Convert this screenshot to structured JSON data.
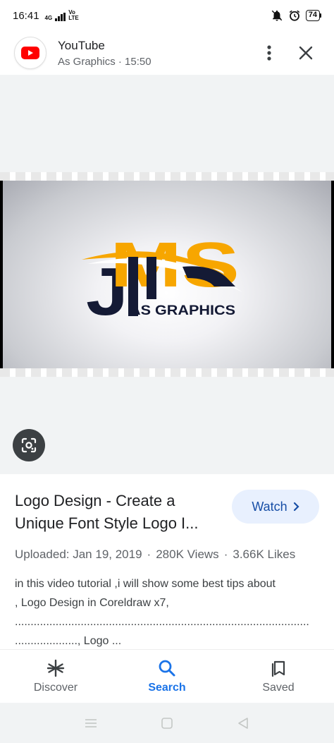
{
  "status_bar": {
    "time": "16:41",
    "network_label": "4G",
    "volte_label": "Vo LTE",
    "battery_level": "74"
  },
  "header": {
    "app_name": "YouTube",
    "source": "As Graphics",
    "separator": "·",
    "time": "15:50",
    "icons": {
      "app": "youtube-logo",
      "more": "more-vert-icon",
      "close": "close-icon"
    }
  },
  "thumbnail": {
    "logo_letters": "JMS",
    "logo_tagline": "AS GRAPHICS",
    "colors": {
      "navy": "#141a35",
      "orange": "#f7a600"
    },
    "lens_icon": "google-lens-icon"
  },
  "video": {
    "title_line1": "Logo Design - Create a",
    "title_line2": "Unique Font Style Logo I...",
    "watch_label": "Watch",
    "uploaded": "Uploaded: Jan 19, 2019",
    "views": "280K Views",
    "likes": "3.66K Likes",
    "meta_separator": "·",
    "desc_line1": "in this video tutorial ,i will show some best tips about",
    "desc_line2": ", Logo Design in Coreldraw x7,",
    "desc_line3": "..............................................................................................",
    "desc_line4": "...................., Logo ..."
  },
  "bottom_nav": {
    "items": [
      {
        "label": "Discover",
        "icon": "discover-asterisk-icon"
      },
      {
        "label": "Search",
        "icon": "search-icon",
        "active": true
      },
      {
        "label": "Saved",
        "icon": "saved-collection-icon"
      }
    ],
    "accent_color": "#1a73e8"
  }
}
